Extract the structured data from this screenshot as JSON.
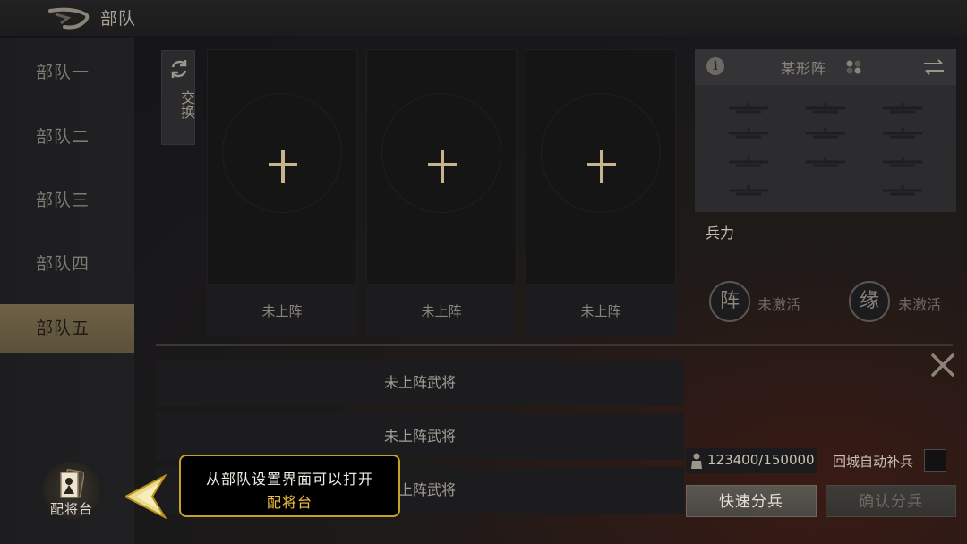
{
  "header": {
    "title": "部队",
    "back_icon": "back-arrow-icon"
  },
  "sidebar": {
    "items": [
      {
        "label": "部队一",
        "active": false
      },
      {
        "label": "部队二",
        "active": false
      },
      {
        "label": "部队三",
        "active": false
      },
      {
        "label": "部队四",
        "active": false
      },
      {
        "label": "部队五",
        "active": true
      }
    ]
  },
  "swap": {
    "label": "交换",
    "icon": "refresh-icon"
  },
  "slots": [
    {
      "status": "未上阵",
      "icon": "plus-icon"
    },
    {
      "status": "未上阵",
      "icon": "plus-icon"
    },
    {
      "status": "未上阵",
      "icon": "plus-icon"
    }
  ],
  "formation": {
    "name": "某形阵",
    "info_icon": "i",
    "troops_label": "兵力",
    "formation_bond": {
      "glyph": "阵",
      "status": "未激活"
    },
    "fate_bond": {
      "glyph": "缘",
      "status": "未激活"
    }
  },
  "list": {
    "rows": [
      {
        "text": "未上阵武将"
      },
      {
        "text": "未上阵武将"
      },
      {
        "text": "未上阵武将"
      }
    ]
  },
  "troops": {
    "count": "123400/150000",
    "auto_replenish_label": "回城自动补兵",
    "auto_replenish_checked": false
  },
  "actions": {
    "quick_split": "快速分兵",
    "confirm_split": "确认分兵"
  },
  "general_stage": {
    "label": "配将台",
    "icon": "general-card-icon"
  },
  "tooltip": {
    "text": "从部队设置界面可以打开",
    "highlight": "配将台"
  },
  "colors": {
    "accent_gold": "#c9a12a",
    "highlight_yellow": "#f0c040",
    "active_tab": "#6e6147"
  }
}
